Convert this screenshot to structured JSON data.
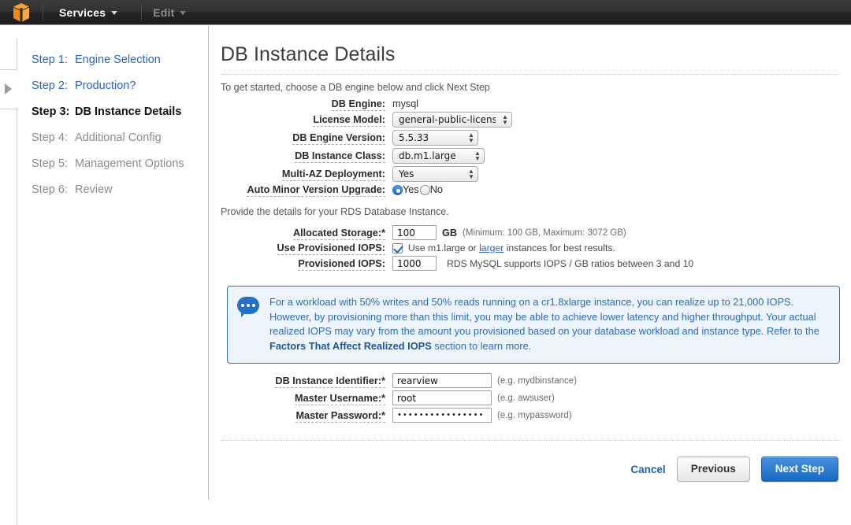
{
  "topnav": {
    "logo_icon": "aws-cube-icon",
    "services_label": "Services",
    "edit_label": "Edit"
  },
  "rail": {
    "expand_icon": "triangle-right-icon"
  },
  "sidebar": {
    "steps": [
      {
        "num": "Step 1:",
        "label": "Engine Selection",
        "state": "link"
      },
      {
        "num": "Step 2:",
        "label": "Production?",
        "state": "link"
      },
      {
        "num": "Step 3:",
        "label": "DB Instance Details",
        "state": "current"
      },
      {
        "num": "Step 4:",
        "label": "Additional Config",
        "state": "future"
      },
      {
        "num": "Step 5:",
        "label": "Management Options",
        "state": "future"
      },
      {
        "num": "Step 6:",
        "label": "Review",
        "state": "future"
      }
    ]
  },
  "main": {
    "title": "DB Instance Details",
    "intro": "To get started, choose a DB engine below and click Next Step",
    "sub_intro": "Provide the details for your RDS Database Instance.",
    "fields": {
      "db_engine": {
        "label": "DB Engine:",
        "value": "mysql"
      },
      "license_model": {
        "label": "License Model:",
        "value": "general-public-license"
      },
      "db_engine_version": {
        "label": "DB Engine Version:",
        "value": "5.5.33"
      },
      "db_instance_class": {
        "label": "DB Instance Class:",
        "value": "db.m1.large"
      },
      "multi_az": {
        "label": "Multi-AZ Deployment:",
        "value": "Yes"
      },
      "auto_minor_upgrade": {
        "label": "Auto Minor Version Upgrade:",
        "yes_label": "Yes",
        "no_label": "No",
        "selected": "Yes"
      },
      "allocated_storage": {
        "label": "Allocated Storage:*",
        "value": "100",
        "unit": "GB",
        "hint": "(Minimum: 100 GB, Maximum: 3072 GB)"
      },
      "use_provisioned_iops": {
        "label": "Use Provisioned IOPS:",
        "checked": true,
        "hint_before": "Use m1.large or ",
        "hint_link": "larger",
        "hint_after": " instances for best results."
      },
      "provisioned_iops": {
        "label": "Provisioned IOPS:",
        "value": "1000",
        "hint": "RDS MySQL supports IOPS / GB ratios between 3 and 10"
      },
      "db_instance_identifier": {
        "label": "DB Instance Identifier:*",
        "value": "rearview",
        "hint": "(e.g. mydbinstance)"
      },
      "master_username": {
        "label": "Master Username:*",
        "value": "root",
        "hint": "(e.g. awsuser)"
      },
      "master_password": {
        "label": "Master Password:*",
        "value": "••••••••••••••••",
        "hint": "(e.g. mypassword)"
      }
    },
    "callout": {
      "icon": "speech-bubble-icon",
      "text_1": "For a workload with 50% writes and 50% reads running on a cr1.8xlarge instance, you can realize up to 21,000 IOPS. However, by provisioning more than this limit, you may be able to achieve lower latency and higher throughput. Your actual realized IOPS may vary from the amount you provisioned based on your database workload and instance type. Refer to the ",
      "link_text": "Factors That Affect Realized IOPS",
      "text_2": " section to learn more."
    },
    "footer": {
      "cancel_label": "Cancel",
      "previous_label": "Previous",
      "next_label": "Next Step"
    }
  },
  "colors": {
    "link_blue": "#2a63c4",
    "primary_blue": "#1769c4",
    "callout_blue": "#2a6cc0",
    "aws_orange": "#f08c1b"
  }
}
